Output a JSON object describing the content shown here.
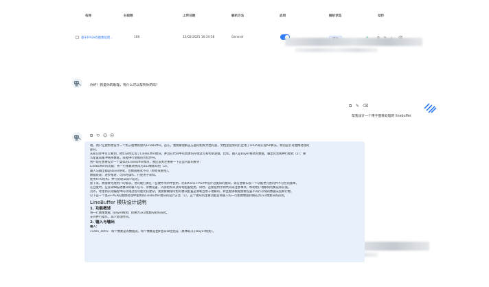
{
  "table": {
    "headers": [
      "名称",
      "分段数",
      "上传日期",
      "解析方法",
      "启用",
      "解析状态",
      "动作"
    ],
    "row": {
      "name": "基于FPGA的图像处理...",
      "chunks": "100",
      "date": "13/02/2025 16:34:58",
      "method": "General",
      "status": "成功"
    }
  },
  "icons": {
    "toggle": "toggle-on-icon",
    "row_actions": [
      "refresh-icon",
      "gear-icon",
      "edit-icon",
      "download-icon",
      "delete-icon"
    ],
    "assistant_avatar": "robot-avatar-icon",
    "user_avatar": "striped-logo-icon",
    "message_actions": [
      "copy-icon",
      "regenerate-icon",
      "like-icon",
      "dislike-icon"
    ],
    "user_message_actions": [
      "copy-icon",
      "edit-icon",
      "delete-icon"
    ]
  },
  "chat": {
    "greeting": "你好！我是你的助理，有什么可以帮到你的吗？",
    "user_message": "帮我设计一个用于图像处理的 linebuffer",
    "answer_lines": [
      "嗯，用户让我帮他设计一个用于图像处理的LineBuffer。首先，我需要理解这方面的相关文档内容，文档里提到的打定用了FPGA来实现ISP算法，特别是针对图像处理的",
      "部分。",
      "从知识库中可以看到，他们已经实现了LineBuffer模块，并且在代码中有具体的存储读写和控制逻辑。比如，输入是Bayer格式的数据，输出包含两种行模式（2）：要",
      "么配置成缓冲两条数据，或者拼行使能的优化传导。",
      "用户现在想要设计一个类似的LineBuffer模块，我应该关注重要一下这些内容的要点：",
      "LineBuffer的功能：将一行像素转换成为3x3像素块组（3），",
      "输入与输出都是Bayer格式，但数据格式不同（原始或重组）。",
      "数据处理：逐步推进，可同时操作，行使用字采样。",
      "使用FIFO结构，并行处理以减少延迟。",
      "接下来，我需要考虑用户的需求。他可能打算在一些硬件项目中使用，比如Xilinx FPGA中设计过类似的模块，现在想要实现一个功能更完善的并不可控的版本。",
      "在回复时，应该详细描述模块的输入信号、参数设置、内部结构以及如何配置使用。同时，还要提供示例代码或注意事项，帮助用户理解如何集成和实施。",
      "另外，考虑到实际编程中的存储过程可能比较复杂，我需要确保所给的模块配置是清晰且易于理解的，并且能够根据需要设置不同行存储的数据长度和行数。",
      "以下是一个基于FPGA的图像处理中使用的LineBuffer模块的设计方案（1）。这个模块的主要功能是将输入的一行图像数据转换成为3x3像素块的形式。"
    ],
    "section_title": "LineBuffer 模块设计说明",
    "subsection_1": "1. 功能概述",
    "sub1_lines": [
      "将一行图像数据（Bayer格式）转换为3x3像素的矩阵形式。",
      "支持并行操作，减少处理时间。"
    ],
    "subsection_2": "2. 输入与输出",
    "io_label": "输入：",
    "io_line": "video_data: 每个像素是的数据流。每个像素是由8位或10位组成（具体取决于Bayer格式）。"
  }
}
